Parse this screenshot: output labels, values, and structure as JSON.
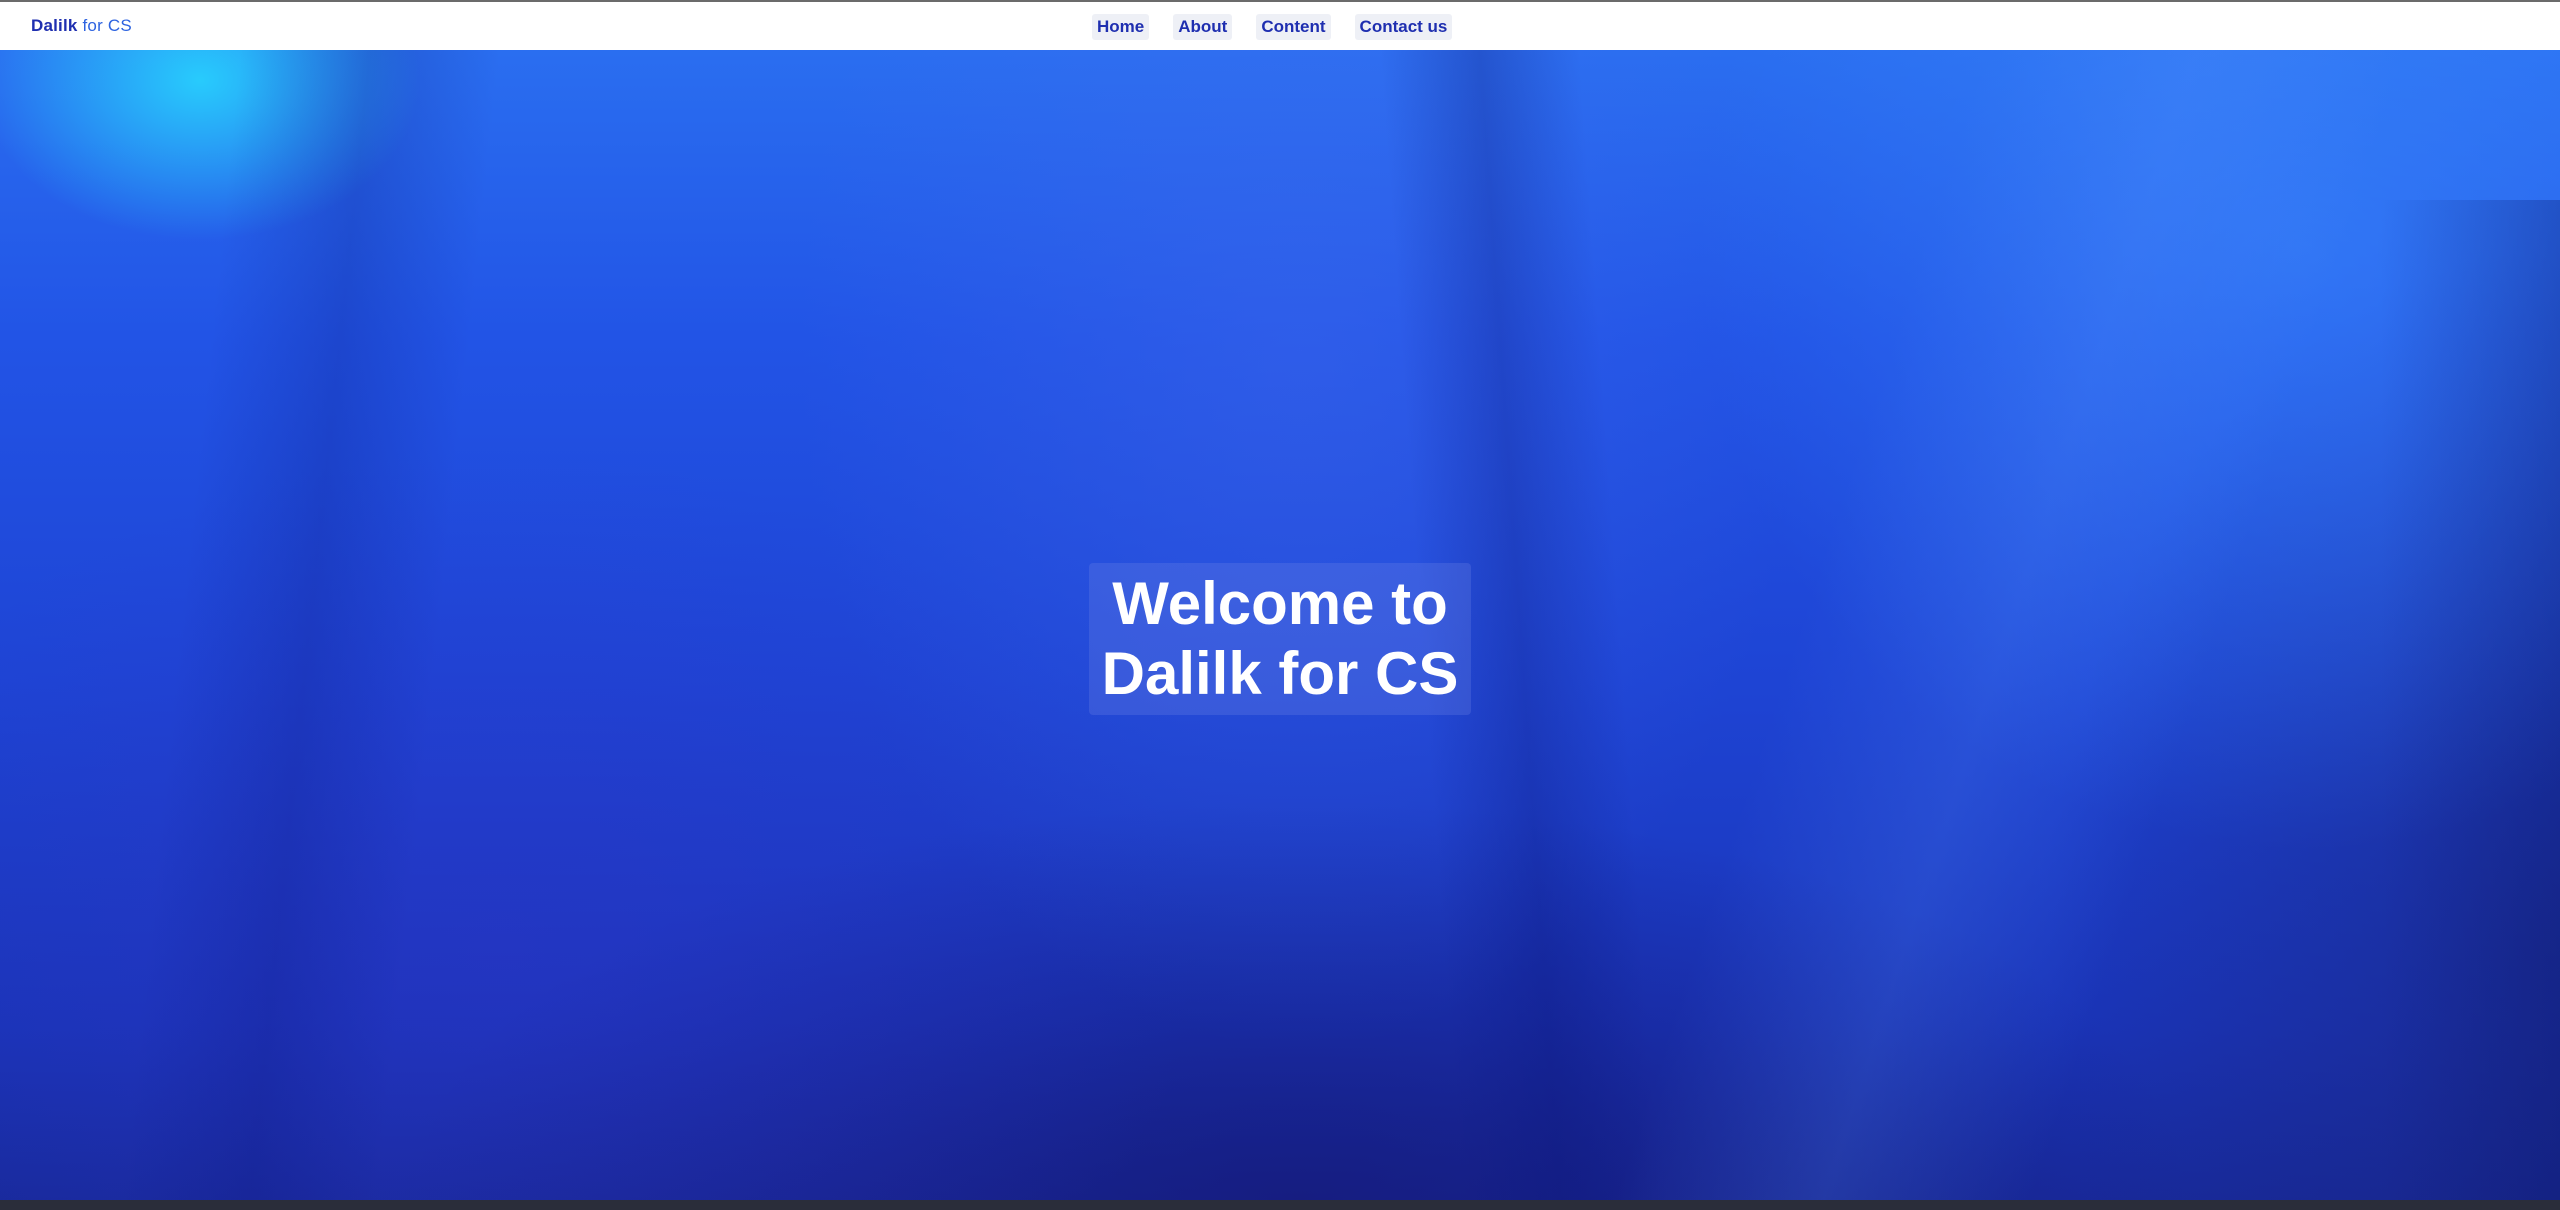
{
  "navbar": {
    "brand_main": "Dalilk",
    "brand_rest": " for CS",
    "links": [
      {
        "label": "Home"
      },
      {
        "label": "About"
      },
      {
        "label": "Content"
      },
      {
        "label": "Contact us"
      }
    ]
  },
  "hero": {
    "title_line1": "Welcome to",
    "title_line2": "Dalilk for CS"
  },
  "colors": {
    "navbar_background": "#ffffff",
    "link_color": "#1f2fb0",
    "hero_primary": "#2254e6",
    "hero_title_color": "#ffffff"
  }
}
